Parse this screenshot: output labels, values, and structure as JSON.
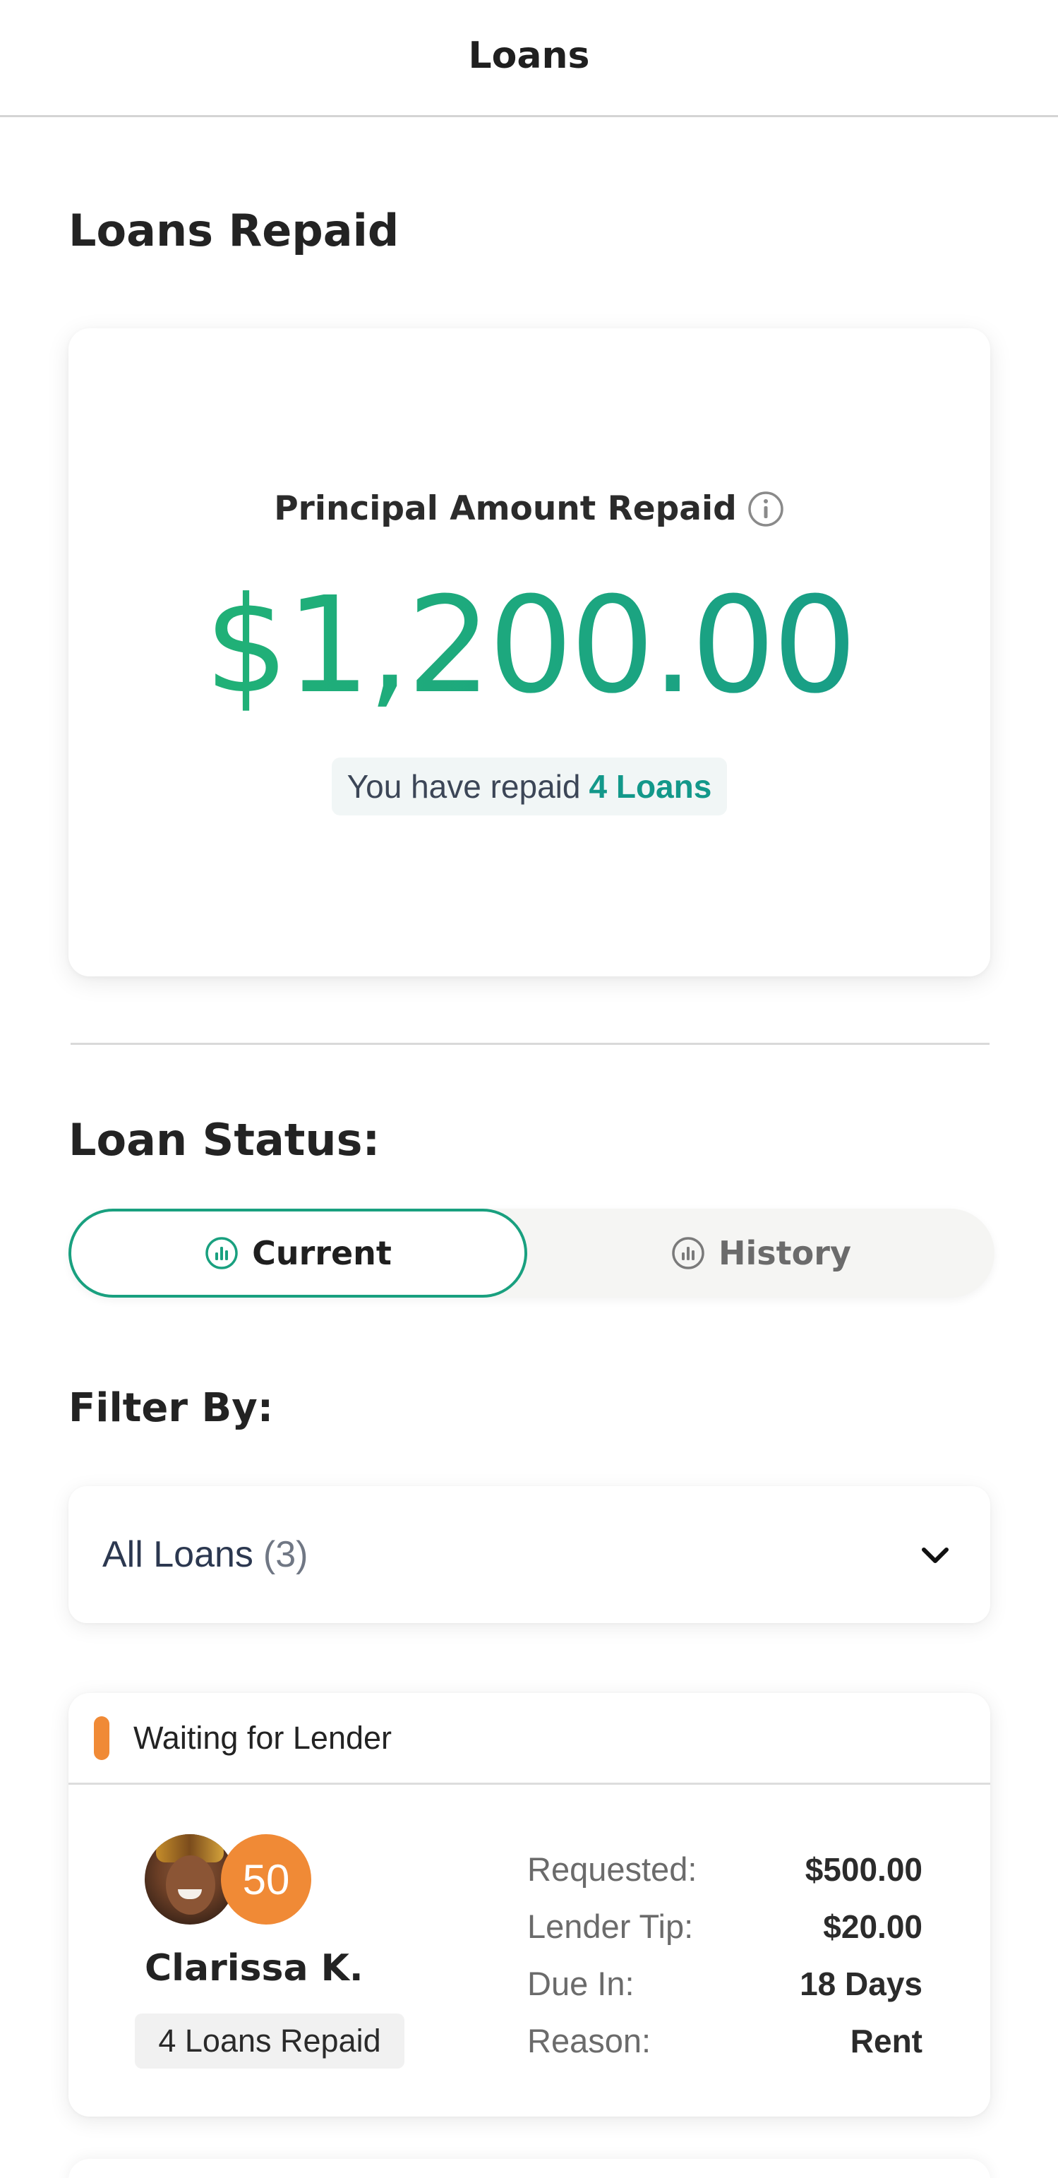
{
  "header": {
    "title": "Loans"
  },
  "summary": {
    "section_title": "Loans Repaid",
    "principal_label": "Principal Amount Repaid",
    "principal_amount": "$1,200.00",
    "repaid_prefix": "You have repaid",
    "repaid_count": "4 Loans",
    "icons": {
      "info": "info-icon"
    },
    "colors": {
      "amount_start": "#22b573",
      "amount_end": "#179a8a",
      "count": "#13988a"
    }
  },
  "loan_status": {
    "title": "Loan Status:",
    "tabs": [
      {
        "label": "Current",
        "active": true,
        "icon": "bar-chart-icon"
      },
      {
        "label": "History",
        "active": false,
        "icon": "bar-chart-icon"
      }
    ],
    "accent": "#19a07f"
  },
  "filter": {
    "title": "Filter By:",
    "selected_label": "All Loans",
    "selected_count": "(3)",
    "icon": "chevron-down-icon"
  },
  "loans": [
    {
      "status": "Waiting for Lender",
      "status_color": "#f08a36",
      "borrower_name": "Clarissa K.",
      "score": "50",
      "loans_repaid": "4 Loans Repaid",
      "details": [
        {
          "label": "Requested:",
          "value": "$500.00"
        },
        {
          "label": "Lender Tip:",
          "value": "$20.00"
        },
        {
          "label": "Due In:",
          "value": "18 Days"
        },
        {
          "label": "Reason:",
          "value": "Rent"
        }
      ]
    }
  ]
}
